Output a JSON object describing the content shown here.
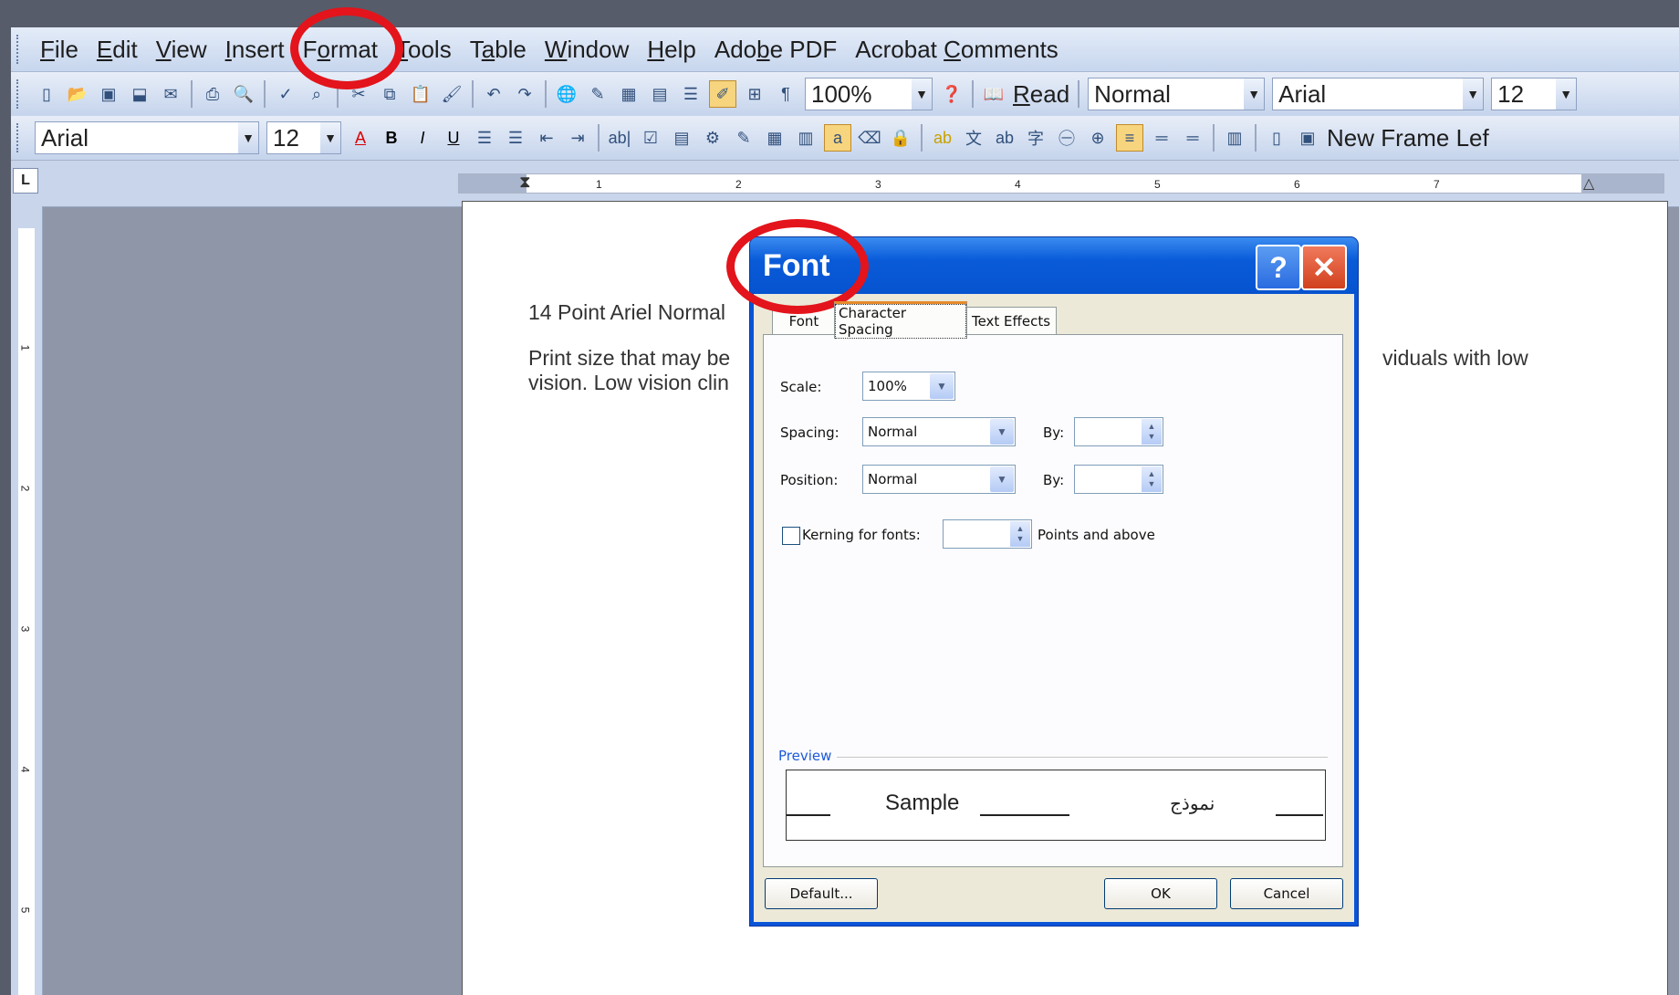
{
  "menubar": {
    "items": [
      {
        "label": "File",
        "ul": "F",
        "rest": "ile"
      },
      {
        "label": "Edit",
        "ul": "E",
        "rest": "dit"
      },
      {
        "label": "View",
        "ul": "V",
        "rest": "iew"
      },
      {
        "label": "Insert",
        "ul": "I",
        "rest": "nsert"
      },
      {
        "label": "Format",
        "pre": "F",
        "ul": "o",
        "rest": "rmat"
      },
      {
        "label": "Tools",
        "ul": "T",
        "rest": "ools"
      },
      {
        "label": "Table",
        "pre": "T",
        "ul": "a",
        "rest": "ble"
      },
      {
        "label": "Window",
        "ul": "W",
        "rest": "indow"
      },
      {
        "label": "Help",
        "ul": "H",
        "rest": "elp"
      },
      {
        "label": "Adobe PDF",
        "pre": "Ado",
        "ul": "b",
        "rest": "e PDF"
      },
      {
        "label": "Acrobat Comments",
        "pre": "Acrobat ",
        "ul": "C",
        "rest": "omments"
      }
    ]
  },
  "toolbar1": {
    "zoom": "100%",
    "read_label": "Read",
    "style": "Normal",
    "font": "Arial",
    "size": "12"
  },
  "toolbar2": {
    "font": "Arial",
    "size": "12",
    "new_frame_label": "New Frame Lef"
  },
  "ruler": {
    "h_numbers": [
      "1",
      "2",
      "3",
      "4",
      "5",
      "6",
      "7"
    ],
    "v_numbers": [
      "1",
      "2",
      "3",
      "4",
      "5"
    ]
  },
  "document": {
    "line1": "14 Point Ariel Normal",
    "line2_start": "Print size that may be",
    "line2_end": "viduals with low",
    "line3_start": "vision. Low vision clin"
  },
  "dialog": {
    "title": "Font",
    "help_glyph": "?",
    "close_glyph": "✕",
    "tabs": [
      "Font",
      "Character Spacing",
      "Text Effects"
    ],
    "active_tab": "Character Spacing",
    "scale_label": "Scale:",
    "scale_value": "100%",
    "spacing_label": "Spacing:",
    "spacing_value": "Normal",
    "by_label_1": "By:",
    "position_label": "Position:",
    "position_value": "Normal",
    "by_label_2": "By:",
    "kerning_label": "Kerning for fonts:",
    "kerning_checked": false,
    "points_label": "Points and above",
    "preview_label": "Preview",
    "preview_sample": "Sample",
    "preview_arabic": "نموذج",
    "default_button": "Default...",
    "ok_button": "OK",
    "cancel_button": "Cancel"
  },
  "annotation_color": "#e3141b",
  "accent_color": "#0a54d8"
}
